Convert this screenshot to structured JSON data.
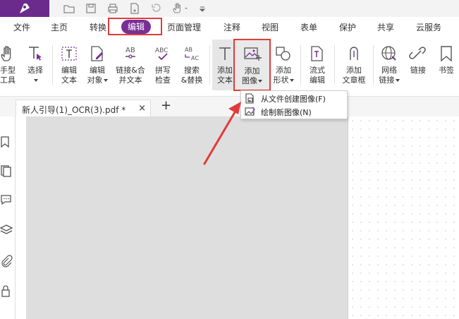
{
  "quick_access": [
    "folder-icon",
    "save-icon",
    "print-icon",
    "new-doc-icon",
    "undo-icon",
    "hand-icon",
    "customize-icon"
  ],
  "menu": {
    "tabs": [
      {
        "label": "文件"
      },
      {
        "label": "主页"
      },
      {
        "label": "转换"
      },
      {
        "label": "编辑",
        "active": true
      },
      {
        "label": "页面管理"
      },
      {
        "label": "注释"
      },
      {
        "label": "视图"
      },
      {
        "label": "表单"
      },
      {
        "label": "保护"
      },
      {
        "label": "共享"
      },
      {
        "label": "云服务"
      }
    ]
  },
  "ribbon": {
    "hand_tool": {
      "line1": "手型",
      "line2": "工具"
    },
    "select": {
      "line1": "选择"
    },
    "edit_text": {
      "line1": "编辑",
      "line2": "文本"
    },
    "edit_object": {
      "line1": "编辑",
      "line2": "对象"
    },
    "link_merge": {
      "line1": "链接&合",
      "line2": "并文本"
    },
    "spell_check": {
      "line1": "拼写",
      "line2": "检查"
    },
    "search_replace": {
      "line1": "搜索",
      "line2": "&替换"
    },
    "add_text": {
      "line1": "添加",
      "line2": "文本"
    },
    "add_image": {
      "line1": "添加",
      "line2": "图像"
    },
    "add_shape": {
      "line1": "添加",
      "line2": "形状"
    },
    "flow_edit": {
      "line1": "流式",
      "line2": "编辑"
    },
    "add_textbox": {
      "line1": "添加",
      "line2": "文章框"
    },
    "web_link": {
      "line1": "网络",
      "line2": "链接"
    },
    "link": {
      "line1": "链接"
    },
    "bookmark": {
      "line1": "书签"
    }
  },
  "dropdown": {
    "items": [
      {
        "label": "从文件创建图像(F)",
        "icon": "image-from-file-icon"
      },
      {
        "label": "绘制新图像(N)",
        "icon": "draw-image-icon"
      }
    ]
  },
  "document_tab": {
    "label": "新人引导(1)_OCR(3).pdf *",
    "close": "×",
    "new_tab": "+"
  },
  "side_panel": [
    "bookmark-icon",
    "pages-icon",
    "comment-icon",
    "layers-icon",
    "attachment-icon",
    "security-icon"
  ],
  "colors": {
    "brand": "#6b2b8c",
    "active_tab": "#7a2e96",
    "highlight": "#e23a3a",
    "workspace": "#dedede"
  }
}
